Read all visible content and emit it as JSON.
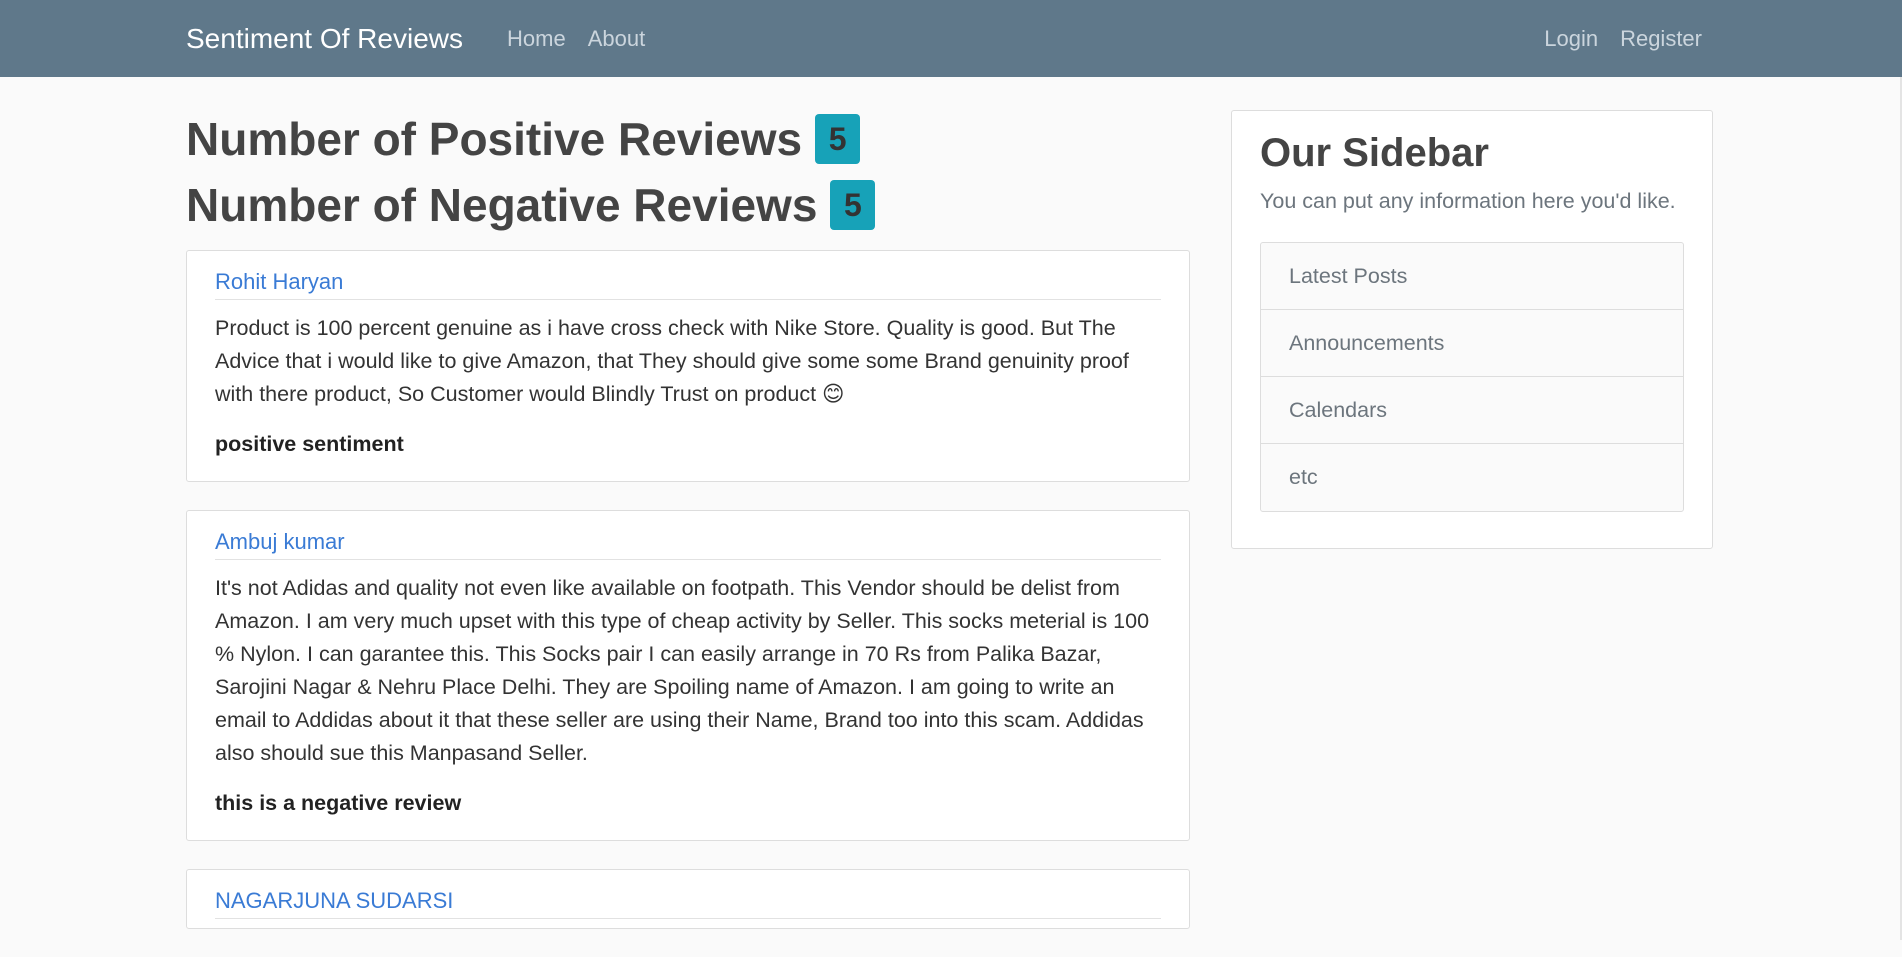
{
  "navbar": {
    "brand": "Sentiment Of Reviews",
    "links": [
      "Home",
      "About"
    ],
    "right_links": [
      "Login",
      "Register"
    ]
  },
  "counts": {
    "positive_label": "Number of Positive Reviews",
    "positive_count": "5",
    "negative_label": "Number of Negative Reviews",
    "negative_count": "5"
  },
  "reviews": [
    {
      "author": "Rohit Haryan",
      "text": "Product is 100 percent genuine as i have cross check with Nike Store. Quality is good. But The Advice that i would like to give Amazon, that They should give some some Brand genuinity proof with there product, So Customer would Blindly Trust on product 😊",
      "sentiment": "positive sentiment"
    },
    {
      "author": "Ambuj kumar",
      "text": "It's not Adidas and quality not even like available on footpath. This Vendor should be delist from Amazon. I am very much upset with this type of cheap activity by Seller. This socks meterial is 100 % Nylon. I can garantee this. This Socks pair I can easily arrange in 70 Rs from Palika Bazar, Sarojini Nagar & Nehru Place Delhi. They are Spoiling name of Amazon. I am going to write an email to Addidas about it that these seller are using their Name, Brand too into this scam. Addidas also should sue this Manpasand Seller.",
      "sentiment": "this is a negative review"
    },
    {
      "author": "NAGARJUNA SUDARSI",
      "text": "",
      "sentiment": ""
    }
  ],
  "sidebar": {
    "title": "Our Sidebar",
    "description": "You can put any information here you'd like.",
    "items": [
      "Latest Posts",
      "Announcements",
      "Calendars",
      "etc"
    ]
  }
}
